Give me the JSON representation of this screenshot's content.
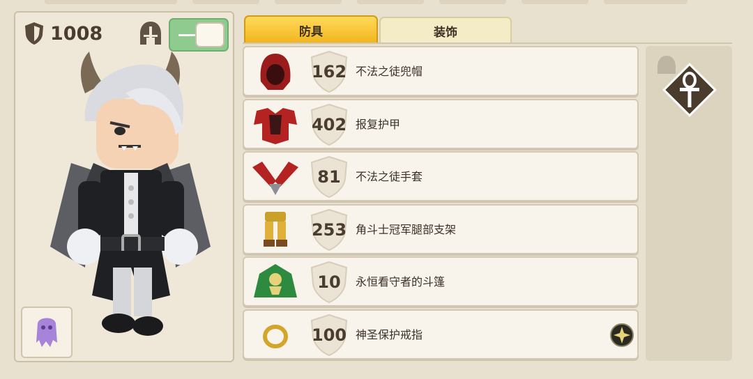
{
  "armor_total": {
    "value": "1008",
    "icon": "shield-icon"
  },
  "helmet_visibility": {
    "icon": "helmet-icon",
    "toggle_on": true
  },
  "tabs": [
    {
      "label": "防具",
      "active": true
    },
    {
      "label": "装饰",
      "active": false
    }
  ],
  "items": [
    {
      "power": "162",
      "name": "不法之徒兜帽",
      "icon": "red-hood-icon"
    },
    {
      "power": "402",
      "name": "报复护甲",
      "icon": "red-chest-armor-icon"
    },
    {
      "power": "81",
      "name": "不法之徒手套",
      "icon": "red-gloves-icon"
    },
    {
      "power": "253",
      "name": "角斗士冠军腿部支架",
      "icon": "gold-leg-armor-icon"
    },
    {
      "power": "10",
      "name": "永恒看守者的斗篷",
      "icon": "green-cloak-icon"
    },
    {
      "power": "100",
      "name": "神圣保护戒指",
      "icon": "gold-ring-icon",
      "enchant_icon": "star-badge-icon"
    }
  ],
  "side_slot": {
    "icon": "ankh-icon",
    "badge_icon": "helmet-icon"
  },
  "colors": {
    "active_tab": "#f7c233",
    "toggle": "#8fcb8f",
    "panel_bg": "#efe8d8"
  }
}
